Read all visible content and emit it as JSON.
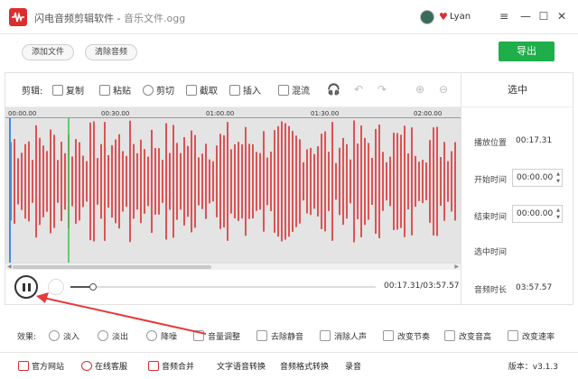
{
  "app": {
    "name": "闪电音频剪辑软件",
    "separator": "-",
    "file": "音乐文件.ogg",
    "user": "Lyan",
    "window_controls": [
      "≡",
      "—",
      "☐",
      "✕"
    ]
  },
  "header": {
    "add_file": "添加文件",
    "clear_audio": "清除音频",
    "export": "导出"
  },
  "toolbar": {
    "label": "剪辑:",
    "copy": "复制",
    "paste": "粘贴",
    "cut": "剪切",
    "crop": "截取",
    "insert": "插入",
    "mix": "混流"
  },
  "timeline": {
    "ticks": [
      "00:00.00",
      "00:30.00",
      "01:00.00",
      "01:30.00",
      "02:00.00"
    ]
  },
  "side": {
    "title": "选中",
    "play_position_label": "播放位置",
    "play_position": "00:17.31",
    "start_label": "开始时间",
    "start_value": "00:00.00",
    "end_label": "结束时间",
    "end_value": "00:00.00",
    "selected_label": "选中时间",
    "duration_label": "音频时长",
    "duration_value": "03:57.57"
  },
  "transport": {
    "time": "00:17.31/03:57.57",
    "progress_fraction": 0.073
  },
  "effects": {
    "label": "效果:",
    "items": [
      "淡入",
      "淡出",
      "降噪",
      "音量调整",
      "去除静音",
      "消除人声",
      "改变节奏",
      "改变音高",
      "改变速率"
    ]
  },
  "bottom": {
    "items": [
      "官方网站",
      "在线客服",
      "音频合并",
      "文字语音转换",
      "音频格式转换",
      "录音"
    ],
    "version_label": "版本：",
    "version": "v3.1.3"
  },
  "colors": {
    "accent_red": "#d92f2f",
    "export_green": "#1fae4a",
    "wave_red": "#d92f2f",
    "playhead_blue": "#3d8fe0",
    "marker_green": "#3cc24f",
    "annotation_arrow": "#e53b3b"
  },
  "icons": {
    "logo": "audio-wave-logo-icon",
    "heart": "heart-icon",
    "pause": "pause-icon"
  }
}
